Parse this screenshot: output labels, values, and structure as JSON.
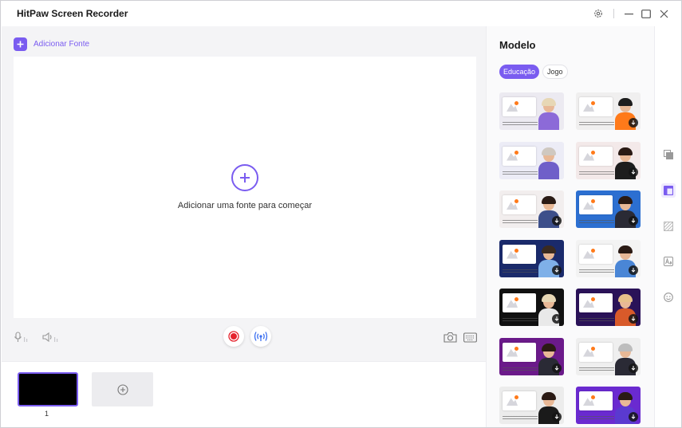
{
  "app": {
    "title": "HitPaw Screen Recorder"
  },
  "workspace": {
    "add_source_label": "Adicionar Fonte",
    "canvas_prompt": "Adicionar uma fonte para começar"
  },
  "scenes": {
    "items": [
      {
        "number": "1"
      }
    ]
  },
  "panel": {
    "title": "Modelo",
    "tabs": [
      {
        "label": "Educação",
        "active": true
      },
      {
        "label": "Jogo",
        "active": false
      }
    ]
  },
  "templates": [
    {
      "bg": "#eceaf1",
      "body": "#8c6ad8",
      "hair": "#e7d7b5",
      "download": false
    },
    {
      "bg": "#f0efef",
      "body": "#ff7a1a",
      "hair": "#1d1d1d",
      "download": true
    },
    {
      "bg": "#ececf6",
      "body": "#6f5fc9",
      "hair": "#cfc8c0",
      "download": false
    },
    {
      "bg": "#f3e9e9",
      "body": "#1d1d1d",
      "hair": "#2a1a14",
      "download": true
    },
    {
      "bg": "#f2eeee",
      "body": "#3d4f8a",
      "hair": "#2a1a14",
      "download": true
    },
    {
      "bg": "#2c6fd1",
      "body": "#2a2a35",
      "hair": "#2a1a14",
      "download": true
    },
    {
      "bg": "#1a2a6b",
      "body": "#7fb0e8",
      "hair": "#3a2a20",
      "download": true
    },
    {
      "bg": "#f3f3f3",
      "body": "#4a86d6",
      "hair": "#2a1a14",
      "download": true
    },
    {
      "bg": "#111111",
      "body": "#e9e9e9",
      "hair": "#e7d7b5",
      "download": true
    },
    {
      "bg": "#2a1258",
      "body": "#d85a2a",
      "hair": "#e7c08a",
      "download": true
    },
    {
      "bg": "#6b1a8a",
      "body": "#2a2a35",
      "hair": "#2a1a14",
      "download": true
    },
    {
      "bg": "#efefef",
      "body": "#2a2a35",
      "hair": "#bdbdbd",
      "download": true
    },
    {
      "bg": "#ececec",
      "body": "#1a1a1a",
      "hair": "#2a1a14",
      "download": true
    },
    {
      "bg": "#6a2ad0",
      "body": "#5a3ad0",
      "hair": "#2a1a14",
      "download": true
    }
  ],
  "icons": {
    "settings": "gear-icon",
    "minimize": "minimize-icon",
    "maximize": "maximize-icon",
    "close": "close-icon"
  },
  "colors": {
    "accent": "#7a5cf0",
    "record": "#e5232d"
  }
}
